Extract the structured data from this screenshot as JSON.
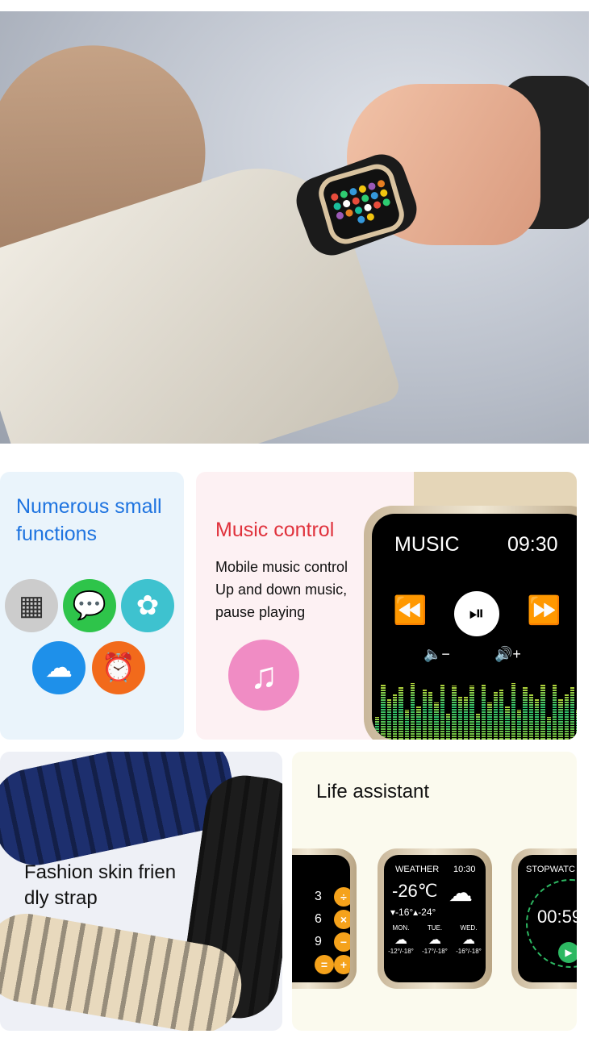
{
  "panels": {
    "small_functions": {
      "title_line1": "Numerous small",
      "title_line2": "functions",
      "apps": [
        "calculator-icon",
        "message-icon",
        "photos-icon",
        "weather-icon",
        "alarm-clock-icon"
      ]
    },
    "music": {
      "title": "Music control",
      "lines": [
        "Mobile music control",
        "Up and down music,",
        "pause playing"
      ],
      "screen_title": "MUSIC",
      "screen_time": "09:30",
      "icon": "music-note-icon"
    },
    "strap": {
      "title_line1": "Fashion skin frien",
      "title_line2": "dly strap",
      "strap_colors": [
        "#1d2f6e",
        "#1c1c1c",
        "#e8d9bd"
      ]
    },
    "life": {
      "title": "Life assistant",
      "calculator": {
        "digits": [
          "3",
          "6",
          "9"
        ],
        "ops": [
          "÷",
          "×",
          "−",
          "=",
          "+"
        ]
      },
      "weather": {
        "title": "WEATHER",
        "time": "10:30",
        "temp": "-26℃",
        "range": "▾-16°▴-24°",
        "days": [
          {
            "name": "MON.",
            "temp": "-12°/-18°"
          },
          {
            "name": "TUE.",
            "temp": "-17°/-18°"
          },
          {
            "name": "WED.",
            "temp": "-16°/-18°"
          }
        ]
      },
      "stopwatch": {
        "title": "STOPWATC",
        "time": "00:59"
      }
    }
  },
  "colors": {
    "accent_blue": "#1f74e0",
    "accent_red": "#e0323c",
    "music_pink": "#f08cc4"
  }
}
